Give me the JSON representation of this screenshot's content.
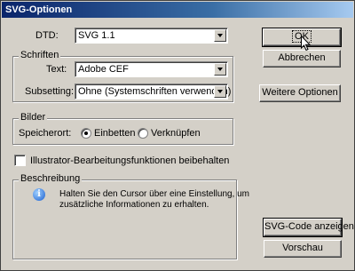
{
  "window": {
    "title": "SVG-Optionen"
  },
  "dtd": {
    "label": "DTD:",
    "value": "SVG 1.1"
  },
  "fonts_group": {
    "legend": "Schriften",
    "text_label": "Text:",
    "text_value": "Adobe CEF",
    "subsetting_label": "Subsetting:",
    "subsetting_value": "Ohne (Systemschriften verwenden)"
  },
  "images_group": {
    "legend": "Bilder",
    "location_label": "Speicherort:",
    "embed_label": "Einbetten",
    "embed_selected": true,
    "link_label": "Verknüpfen",
    "link_selected": false
  },
  "preserve_editing": {
    "label": "Illustrator-Bearbeitungsfunktionen beibehalten",
    "checked": false
  },
  "description_group": {
    "legend": "Beschreibung",
    "line1": "Halten Sie den Cursor über eine Einstellung, um",
    "line2": "zusätzliche Informationen zu erhalten.",
    "icon": "info-icon"
  },
  "buttons": {
    "ok": "OK",
    "cancel": "Abbrechen",
    "more_options": "Weitere Optionen",
    "show_svg_code": "SVG-Code anzeigen",
    "preview": "Vorschau"
  },
  "colors": {
    "dialog_bg": "#d4d0c8",
    "titlebar_start": "#0a246a",
    "titlebar_end": "#a6caf0",
    "field_bg": "#ffffff"
  }
}
